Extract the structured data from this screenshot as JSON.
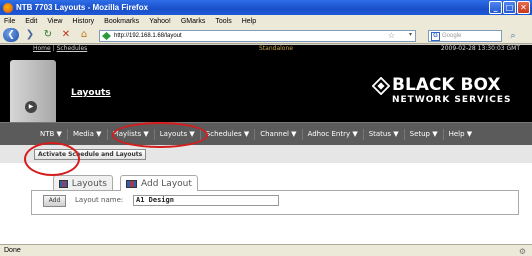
{
  "window": {
    "title": "NTB 7703 Layouts - Mozilla Firefox",
    "controls": [
      "_",
      "□",
      "✕"
    ]
  },
  "menubar": [
    "File",
    "Edit",
    "View",
    "History",
    "Bookmarks",
    "Yahoo!",
    "GMarks",
    "Tools",
    "Help"
  ],
  "navbar": {
    "url": "http://192.168.1.68/layout",
    "search_placeholder": "Google",
    "icons": [
      "back-icon",
      "forward-icon",
      "reload-icon",
      "stop-icon",
      "home-icon",
      "site-icon",
      "bookmark-star-icon",
      "search-icon"
    ]
  },
  "topstrip": {
    "home": "Home",
    "separator": " | ",
    "schedules": "Schedules",
    "mode": "Standalone",
    "timestamp": "2009-02-28 13:30:03 GMT"
  },
  "header": {
    "page_heading": "Layouts",
    "logo_main": "BLACK BOX",
    "logo_sub": "NETWORK SERVICES",
    "play_glyph": "▶"
  },
  "main_menu": [
    "NTB ▼",
    "Media ▼",
    "Playlists ▼",
    "Layouts ▼",
    "Schedules ▼",
    "Channel ▼",
    "Adhoc Entry ▼",
    "Status ▼",
    "Setup ▼",
    "Help ▼"
  ],
  "subbar": {
    "activate_label": "Activate Schedule and Layouts"
  },
  "tabs": [
    {
      "label": "Layouts"
    },
    {
      "label": "Add Layout"
    }
  ],
  "form": {
    "add_label": "Add",
    "name_label": "Layout name:",
    "name_value": "A1 Design"
  },
  "statusbar": {
    "text": "Done"
  },
  "colors": {
    "highlight": "#d61c1c",
    "menu_bg": "#5b5b5b",
    "titlebar": "#2e6ee8"
  }
}
